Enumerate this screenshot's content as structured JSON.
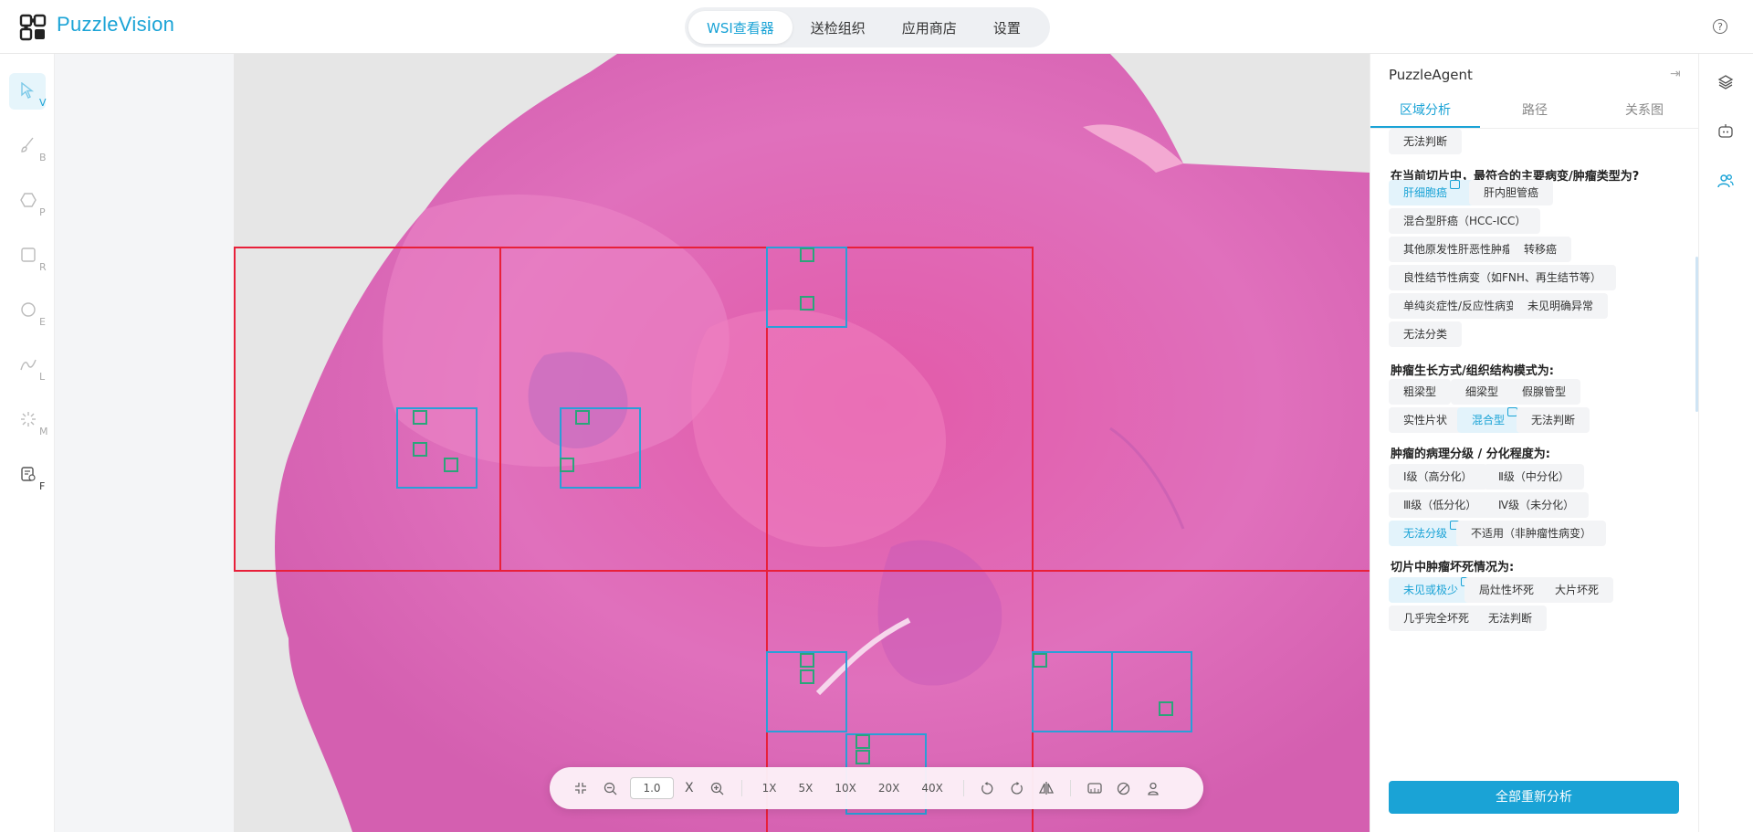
{
  "app": {
    "name": "PuzzleVision"
  },
  "nav": {
    "tabs": [
      {
        "label": "WSI查看器",
        "active": true
      },
      {
        "label": "送检组织",
        "active": false
      },
      {
        "label": "应用商店",
        "active": false
      },
      {
        "label": "设置",
        "active": false
      }
    ]
  },
  "header": {
    "help_icon": "question-circle-icon",
    "help_glyph": "?"
  },
  "tools": [
    {
      "key": "V",
      "icon": "pointer-icon",
      "active": true
    },
    {
      "key": "B",
      "icon": "brush-icon",
      "active": false
    },
    {
      "key": "P",
      "icon": "polygon-icon",
      "active": false
    },
    {
      "key": "R",
      "icon": "rectangle-icon",
      "active": false
    },
    {
      "key": "E",
      "icon": "ellipse-icon",
      "active": false
    },
    {
      "key": "L",
      "icon": "line-icon",
      "active": false
    },
    {
      "key": "M",
      "icon": "magic-wand-icon",
      "active": false
    },
    {
      "key": "F",
      "icon": "file-tag-icon",
      "active": false
    }
  ],
  "zoombar": {
    "zoom_value": "1.0",
    "multiplier": "X",
    "magnifications": [
      "1X",
      "5X",
      "10X",
      "20X",
      "40X"
    ]
  },
  "panel": {
    "title": "PuzzleAgent",
    "collapse_glyph": "⇥",
    "tabs": [
      {
        "label": "区域分析",
        "active": true
      },
      {
        "label": "路径",
        "active": false
      },
      {
        "label": "关系图",
        "active": false
      }
    ],
    "leading_chip": "无法判断",
    "questions": [
      {
        "title": "在当前切片中，最符合的主要病变/肿瘤类型为?",
        "options": [
          {
            "label": "肝细胞癌",
            "selected": true
          },
          {
            "label": "肝内胆管癌",
            "selected": false
          },
          {
            "label": "混合型肝癌（HCC-ICC）",
            "selected": false
          },
          {
            "label": "其他原发性肝恶性肿瘤",
            "selected": false
          },
          {
            "label": "转移癌",
            "selected": false
          },
          {
            "label": "良性结节性病变（如FNH、再生结节等）",
            "selected": false
          },
          {
            "label": "单纯炎症性/反应性病变",
            "selected": false
          },
          {
            "label": "未见明确异常",
            "selected": false
          },
          {
            "label": "无法分类",
            "selected": false
          }
        ]
      },
      {
        "title": "肿瘤生长方式/组织结构模式为:",
        "options": [
          {
            "label": "粗梁型",
            "selected": false
          },
          {
            "label": "细梁型",
            "selected": false
          },
          {
            "label": "假腺管型",
            "selected": false
          },
          {
            "label": "实性片状",
            "selected": false
          },
          {
            "label": "混合型",
            "selected": true
          },
          {
            "label": "无法判断",
            "selected": false
          }
        ]
      },
      {
        "title": "肿瘤的病理分级 / 分化程度为:",
        "options": [
          {
            "label": "Ⅰ级（高分化）",
            "selected": false
          },
          {
            "label": "Ⅱ级（中分化）",
            "selected": false
          },
          {
            "label": "Ⅲ级（低分化）",
            "selected": false
          },
          {
            "label": "Ⅳ级（未分化）",
            "selected": false
          },
          {
            "label": "无法分级",
            "selected": true
          },
          {
            "label": "不适用（非肿瘤性病变）",
            "selected": false
          }
        ]
      },
      {
        "title": "切片中肿瘤坏死情况为:",
        "options": [
          {
            "label": "未见或极少",
            "selected": true
          },
          {
            "label": "局灶性坏死",
            "selected": false
          },
          {
            "label": "大片坏死",
            "selected": false
          },
          {
            "label": "几乎完全坏死",
            "selected": false
          },
          {
            "label": "无法判断",
            "selected": false
          }
        ]
      }
    ],
    "reanalyze_button": "全部重新分析"
  },
  "rail": {
    "icons": [
      "layers-icon",
      "robot-icon",
      "users-icon"
    ]
  },
  "colors": {
    "accent": "#1aa3d6",
    "region_red": "#e8203a",
    "region_blue": "#2a9fd8",
    "patch_green": "#2aa57a"
  }
}
